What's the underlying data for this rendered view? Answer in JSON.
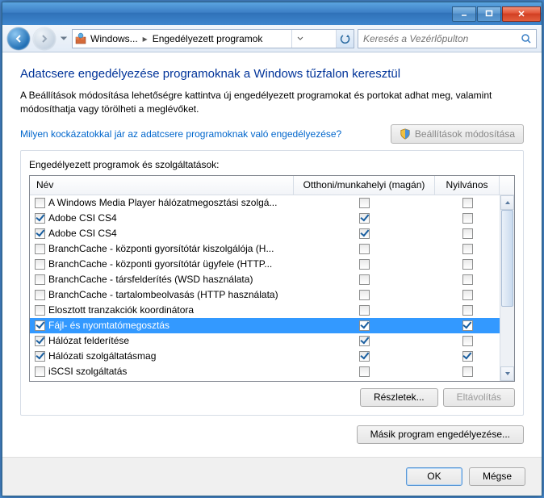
{
  "titlebar": {
    "minimize": "–",
    "maximize": "□",
    "close": "×"
  },
  "breadcrumb": {
    "app": "Windows...",
    "page": "Engedélyezett programok"
  },
  "search": {
    "placeholder": "Keresés a Vezérlőpulton"
  },
  "heading": "Adatcsere engedélyezése programoknak a Windows tűzfalon keresztül",
  "description": "A Beállítások módosítása lehetőségre kattintva új engedélyezett programokat és portokat adhat meg, valamint módosíthatja vagy törölheti a meglévőket.",
  "risklink": "Milyen kockázatokkal jár az adatcsere programoknak való engedélyezése?",
  "settings_button": "Beállítások módosítása",
  "group_title": "Engedélyezett programok és szolgáltatások:",
  "columns": {
    "name": "Név",
    "home": "Otthoni/munkahelyi (magán)",
    "public": "Nyilvános"
  },
  "items": [
    {
      "label": "A Windows Media Player hálózatmegosztási szolgá...",
      "checked": false,
      "home": false,
      "public": false,
      "selected": false
    },
    {
      "label": "Adobe CSI CS4",
      "checked": true,
      "home": true,
      "public": false,
      "selected": false
    },
    {
      "label": "Adobe CSI CS4",
      "checked": true,
      "home": true,
      "public": false,
      "selected": false
    },
    {
      "label": "BranchCache - központi gyorsítótár kiszolgálója (H...",
      "checked": false,
      "home": false,
      "public": false,
      "selected": false
    },
    {
      "label": "BranchCache - központi gyorsítótár ügyfele (HTTP...",
      "checked": false,
      "home": false,
      "public": false,
      "selected": false
    },
    {
      "label": "BranchCache - társfelderítés (WSD használata)",
      "checked": false,
      "home": false,
      "public": false,
      "selected": false
    },
    {
      "label": "BranchCache - tartalombeolvasás (HTTP használata)",
      "checked": false,
      "home": false,
      "public": false,
      "selected": false
    },
    {
      "label": "Elosztott tranzakciók koordinátora",
      "checked": false,
      "home": false,
      "public": false,
      "selected": false
    },
    {
      "label": "Fájl- és nyomtatómegosztás",
      "checked": true,
      "home": true,
      "public": true,
      "selected": true
    },
    {
      "label": "Hálózat felderítése",
      "checked": true,
      "home": true,
      "public": false,
      "selected": false
    },
    {
      "label": "Hálózati szolgáltatásmag",
      "checked": true,
      "home": true,
      "public": true,
      "selected": false
    },
    {
      "label": "iSCSI szolgáltatás",
      "checked": false,
      "home": false,
      "public": false,
      "selected": false
    }
  ],
  "buttons": {
    "details": "Részletek...",
    "remove": "Eltávolítás",
    "allow_other": "Másik program engedélyezése...",
    "ok": "OK",
    "cancel": "Mégse"
  }
}
